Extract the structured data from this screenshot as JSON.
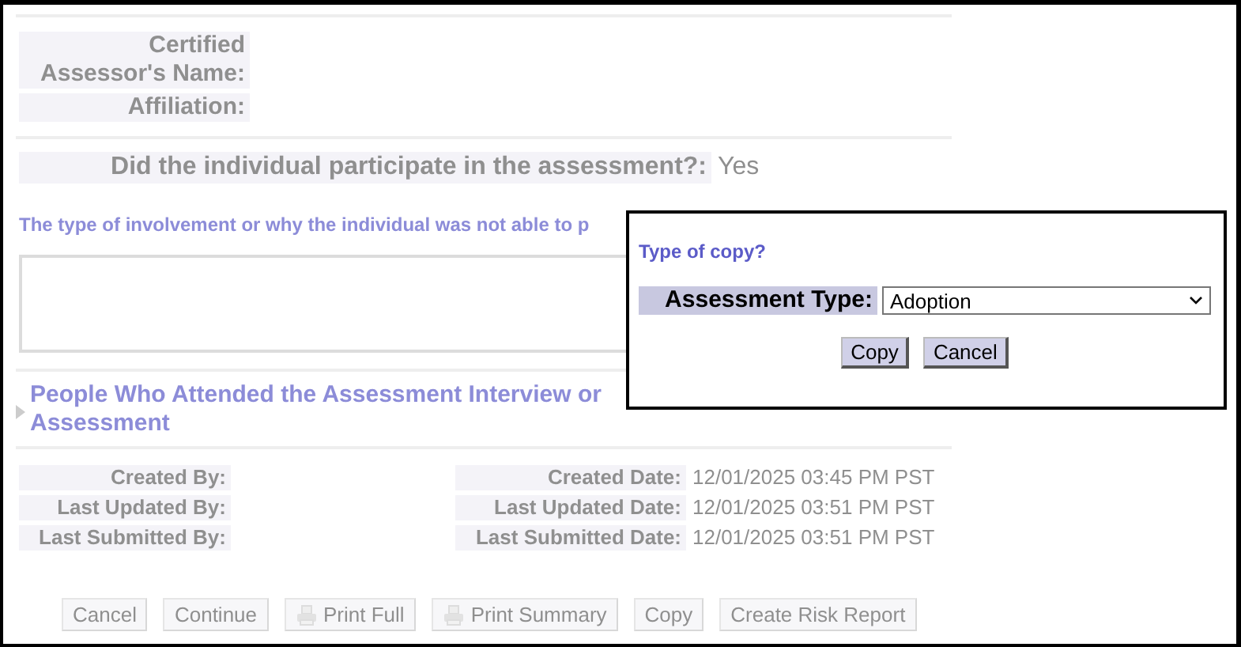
{
  "assessor": {
    "fields": [
      {
        "label": "Certified Assessor's Name:"
      },
      {
        "label": "Affiliation:"
      }
    ]
  },
  "participation": {
    "question": "Did the individual participate in the assessment?:",
    "answer": "Yes"
  },
  "involvement": {
    "label": "The type of involvement or why the individual was not able to p"
  },
  "attendees": {
    "expanded": false,
    "heading_lines": [
      "People Who Attended the Assessment Interview or",
      "Assessment"
    ]
  },
  "audit": {
    "left": [
      {
        "label": "Created By:"
      },
      {
        "label": "Last Updated By:"
      },
      {
        "label": "Last Submitted By:"
      }
    ],
    "right": [
      {
        "label": "Created Date:",
        "value": "12/01/2025 03:45 PM PST"
      },
      {
        "label": "Last Updated Date:",
        "value": "12/01/2025 03:51 PM PST"
      },
      {
        "label": "Last Submitted Date:",
        "value": "12/01/2025 03:51 PM PST"
      }
    ]
  },
  "buttons": [
    {
      "label": "Cancel",
      "kind": "plain"
    },
    {
      "label": "Continue",
      "kind": "plain"
    },
    {
      "label": "Print Full",
      "kind": "print"
    },
    {
      "label": "Print Summary",
      "kind": "print"
    },
    {
      "label": "Copy",
      "kind": "plain"
    },
    {
      "label": "Create Risk Report",
      "kind": "plain"
    }
  ],
  "dialog": {
    "title": "Type of copy?",
    "field_label": "Assessment Type:",
    "value": "Adoption",
    "buttons": [
      "Copy",
      "Cancel"
    ]
  }
}
